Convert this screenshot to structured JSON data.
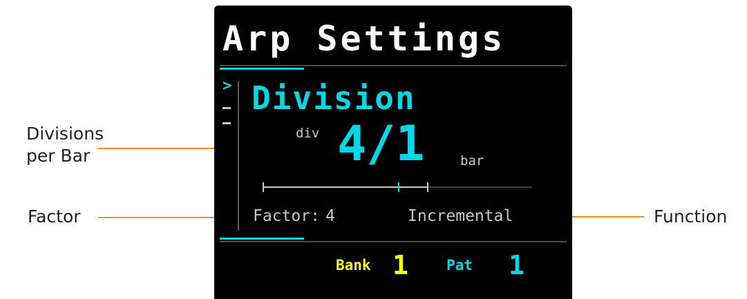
{
  "annotations": {
    "divisions_per_bar_line1": "Divisions",
    "divisions_per_bar_line2": "per Bar",
    "factor": "Factor",
    "function": "Function",
    "leader_color": "#f08a24"
  },
  "screen": {
    "title": "Arp Settings",
    "cursor_glyph": ">",
    "parameter_name": "Division",
    "value_prefix": "div",
    "value": "4/1",
    "value_unit": "bar",
    "slider": {
      "position_fraction": 0.6,
      "marker_fraction": 0.545
    },
    "factor_label": "Factor",
    "factor_separator": ":",
    "factor_value": "4",
    "function_label": "Incremental",
    "bank_label": "Bank",
    "bank_value": "1",
    "pattern_label": "Pat",
    "pattern_value": "1"
  },
  "colors": {
    "background": "#000000",
    "accent_cyan": "#00d8e8",
    "accent_yellow": "#ffff00",
    "text_grey": "#c8c8c8",
    "title_white": "#ffffff"
  }
}
